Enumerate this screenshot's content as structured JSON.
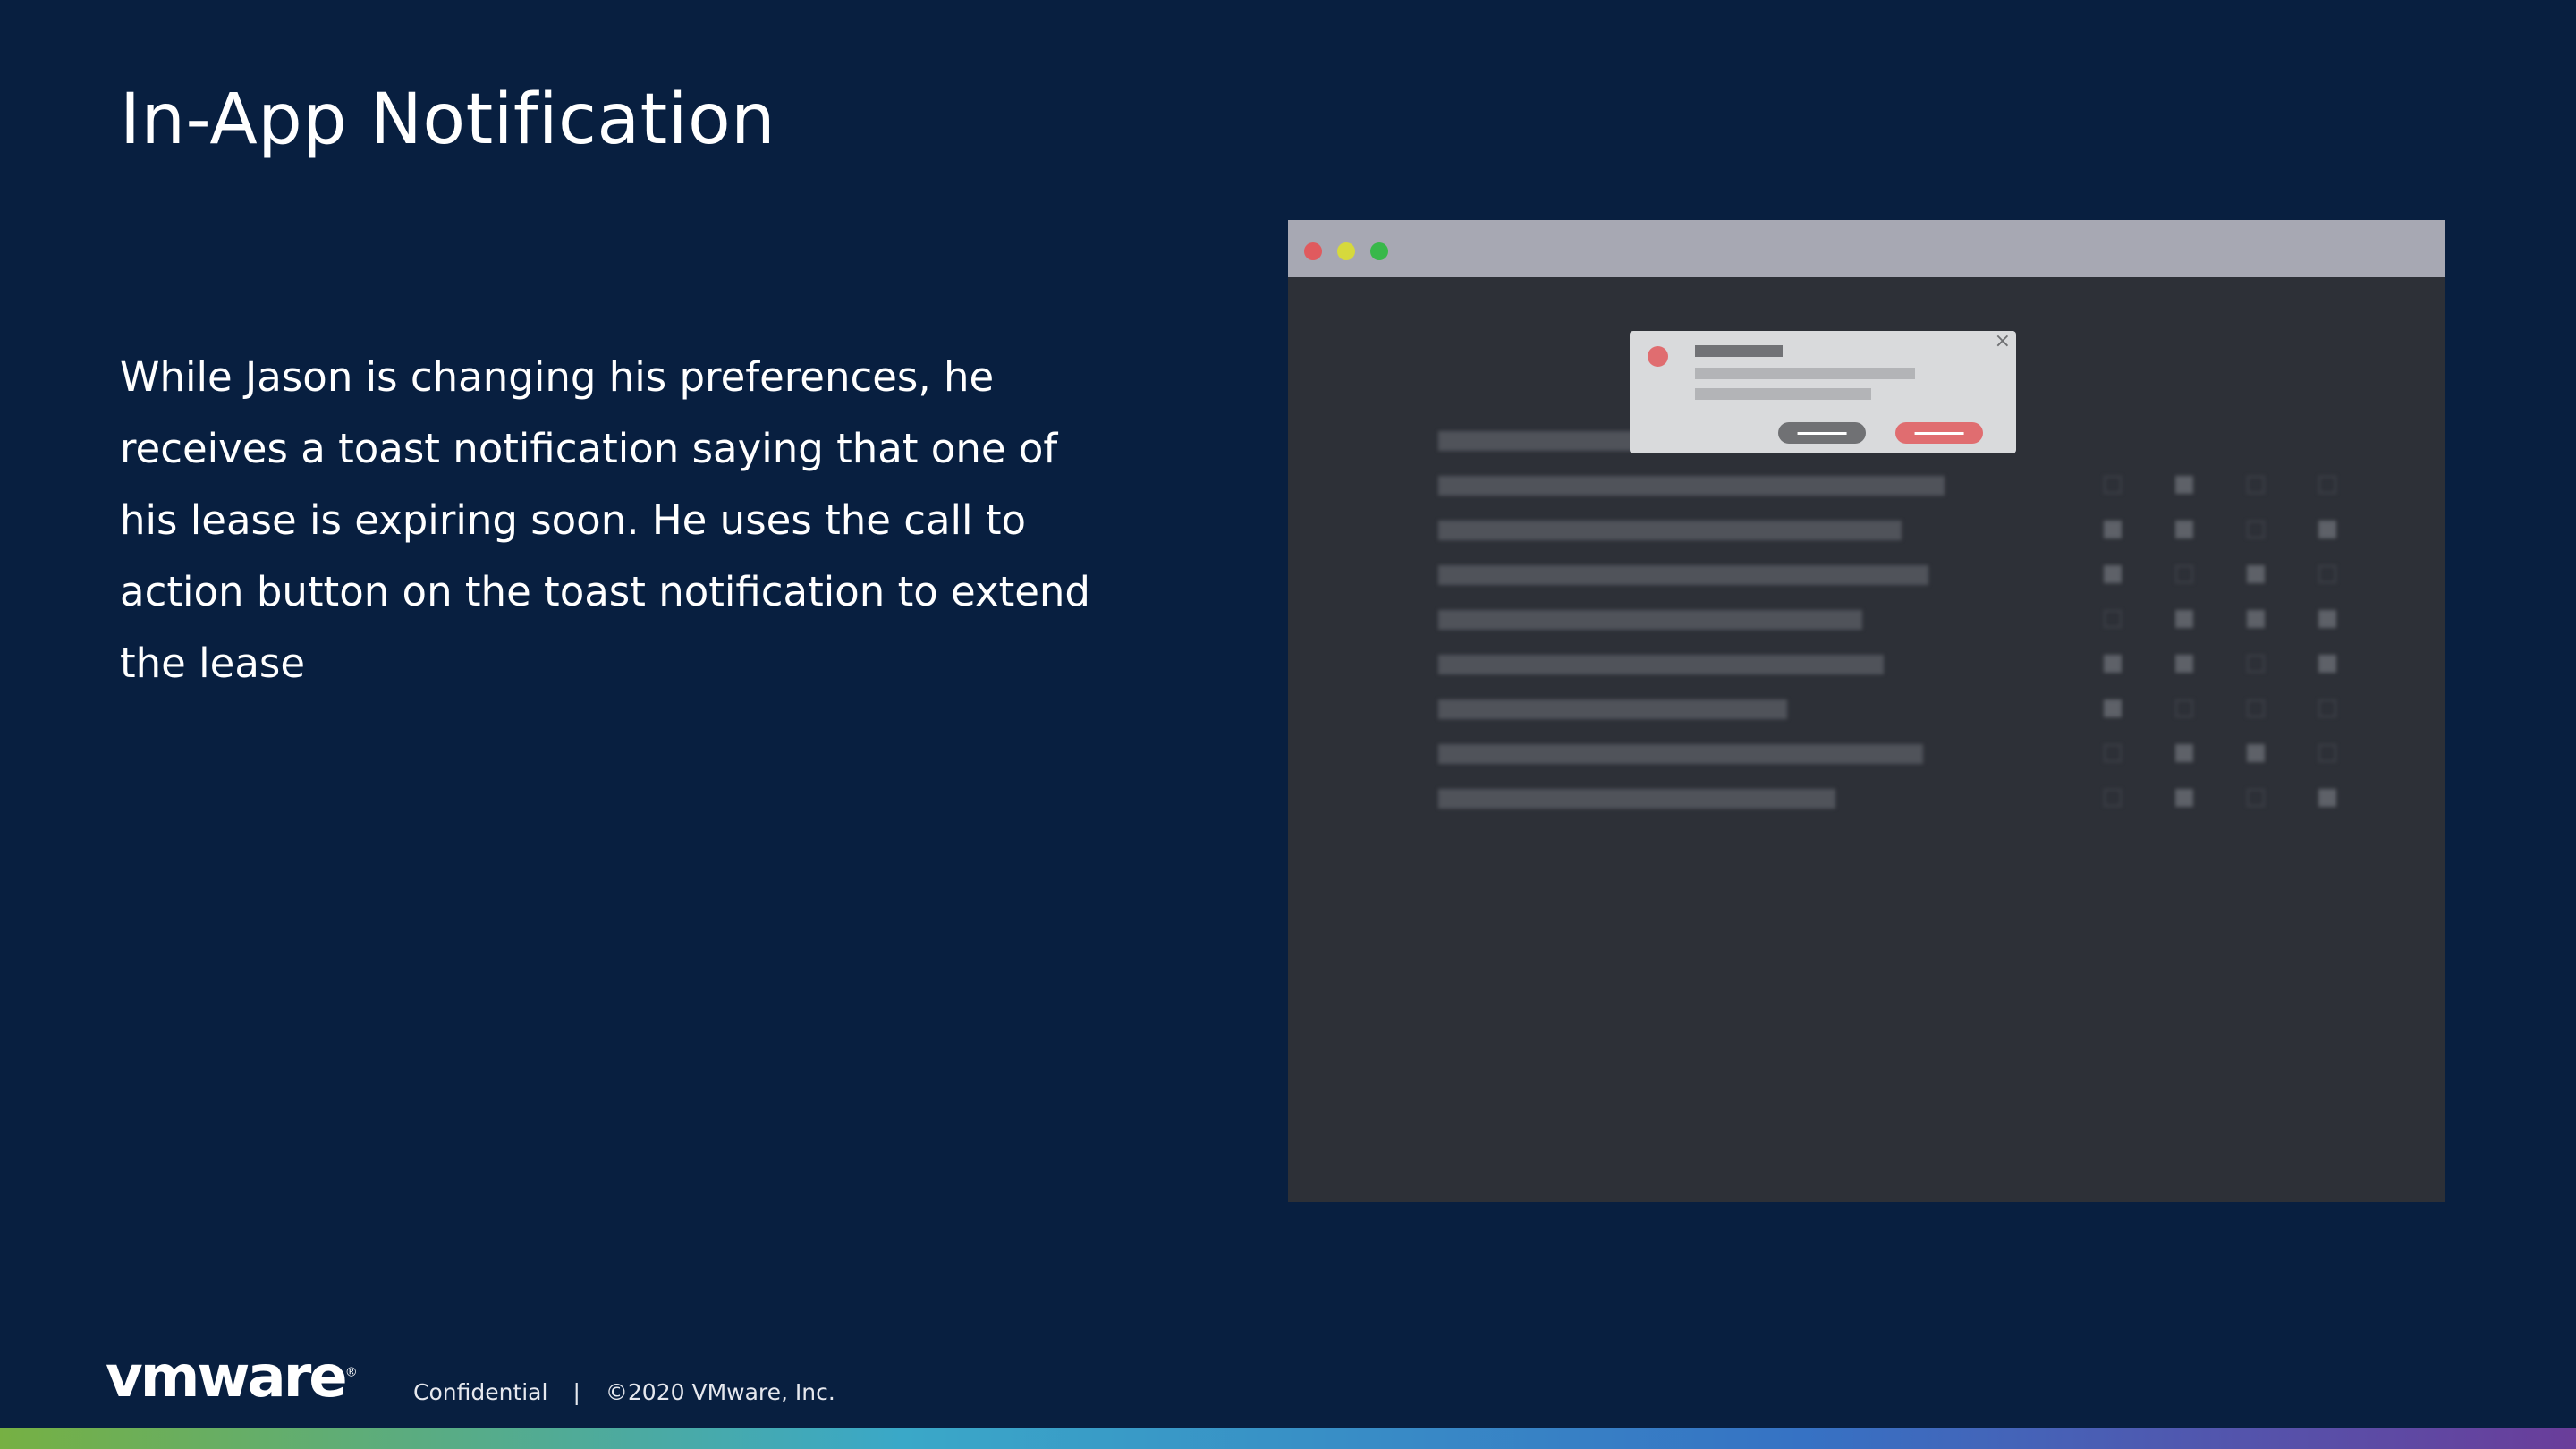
{
  "slide": {
    "title": "In-App Notification",
    "body": "While Jason is changing his preferences, he receives a toast notification saying that one of his lease is expiring soon. He uses the call to action button on the toast notification to extend the lease"
  },
  "footer": {
    "logo": "vmware",
    "logo_mark": "®",
    "confidential": "Confidential",
    "separator": "|",
    "copyright": "©2020 VMware, Inc."
  },
  "mockup": {
    "toast_close": "×"
  },
  "colors": {
    "background": "#081f40",
    "window_body": "#2d3037",
    "window_bar": "#a7a8b3",
    "toast_bg": "#d9dadc",
    "toast_accent": "#e06d70"
  },
  "icons": [
    "close-icon",
    "window-close-dot",
    "window-minimize-dot",
    "window-maximize-dot",
    "alert-dot-icon"
  ]
}
